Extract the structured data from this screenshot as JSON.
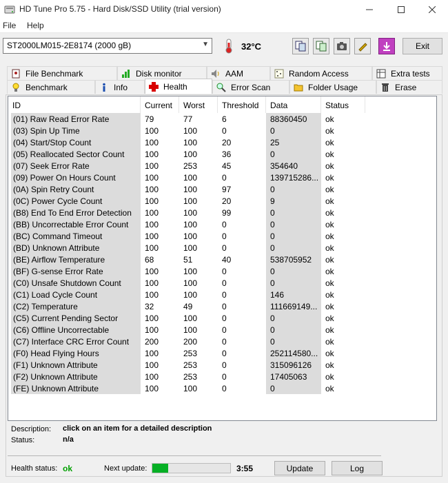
{
  "window": {
    "title": "HD Tune Pro 5.75 - Hard Disk/SSD Utility (trial version)"
  },
  "menu": {
    "file": "File",
    "help": "Help"
  },
  "toolbar": {
    "drive": "ST2000LM015-2E8174 (2000 gB)",
    "temperature": "32°C",
    "exit_label": "Exit"
  },
  "tabs_top": [
    {
      "label": "File Benchmark",
      "icon": "file-benchmark-icon"
    },
    {
      "label": "Disk monitor",
      "icon": "disk-monitor-icon"
    },
    {
      "label": "AAM",
      "icon": "speaker-icon"
    },
    {
      "label": "Random Access",
      "icon": "random-access-icon"
    },
    {
      "label": "Extra tests",
      "icon": "extra-tests-icon"
    }
  ],
  "tabs_bottom": [
    {
      "label": "Benchmark",
      "icon": "benchmark-icon"
    },
    {
      "label": "Info",
      "icon": "info-icon"
    },
    {
      "label": "Health",
      "icon": "health-cross-icon",
      "active": true
    },
    {
      "label": "Error Scan",
      "icon": "magnifier-icon"
    },
    {
      "label": "Folder Usage",
      "icon": "folder-icon"
    },
    {
      "label": "Erase",
      "icon": "trash-icon"
    }
  ],
  "table": {
    "headers": {
      "id": "ID",
      "current": "Current",
      "worst": "Worst",
      "threshold": "Threshold",
      "data": "Data",
      "status": "Status"
    },
    "rows": [
      {
        "id": "(01) Raw Read Error Rate",
        "current": "79",
        "worst": "77",
        "threshold": "6",
        "data": "88360450",
        "status": "ok"
      },
      {
        "id": "(03) Spin Up Time",
        "current": "100",
        "worst": "100",
        "threshold": "0",
        "data": "0",
        "status": "ok"
      },
      {
        "id": "(04) Start/Stop Count",
        "current": "100",
        "worst": "100",
        "threshold": "20",
        "data": "25",
        "status": "ok"
      },
      {
        "id": "(05) Reallocated Sector Count",
        "current": "100",
        "worst": "100",
        "threshold": "36",
        "data": "0",
        "status": "ok"
      },
      {
        "id": "(07) Seek Error Rate",
        "current": "100",
        "worst": "253",
        "threshold": "45",
        "data": "354640",
        "status": "ok"
      },
      {
        "id": "(09) Power On Hours Count",
        "current": "100",
        "worst": "100",
        "threshold": "0",
        "data": "139715286...",
        "status": "ok"
      },
      {
        "id": "(0A) Spin Retry Count",
        "current": "100",
        "worst": "100",
        "threshold": "97",
        "data": "0",
        "status": "ok"
      },
      {
        "id": "(0C) Power Cycle Count",
        "current": "100",
        "worst": "100",
        "threshold": "20",
        "data": "9",
        "status": "ok"
      },
      {
        "id": "(B8) End To End Error Detection",
        "current": "100",
        "worst": "100",
        "threshold": "99",
        "data": "0",
        "status": "ok"
      },
      {
        "id": "(BB) Uncorrectable Error Count",
        "current": "100",
        "worst": "100",
        "threshold": "0",
        "data": "0",
        "status": "ok"
      },
      {
        "id": "(BC) Command Timeout",
        "current": "100",
        "worst": "100",
        "threshold": "0",
        "data": "0",
        "status": "ok"
      },
      {
        "id": "(BD) Unknown Attribute",
        "current": "100",
        "worst": "100",
        "threshold": "0",
        "data": "0",
        "status": "ok"
      },
      {
        "id": "(BE) Airflow Temperature",
        "current": "68",
        "worst": "51",
        "threshold": "40",
        "data": "538705952",
        "status": "ok"
      },
      {
        "id": "(BF) G-sense Error Rate",
        "current": "100",
        "worst": "100",
        "threshold": "0",
        "data": "0",
        "status": "ok"
      },
      {
        "id": "(C0) Unsafe Shutdown Count",
        "current": "100",
        "worst": "100",
        "threshold": "0",
        "data": "0",
        "status": "ok"
      },
      {
        "id": "(C1) Load Cycle Count",
        "current": "100",
        "worst": "100",
        "threshold": "0",
        "data": "146",
        "status": "ok"
      },
      {
        "id": "(C2) Temperature",
        "current": "32",
        "worst": "49",
        "threshold": "0",
        "data": "111669149...",
        "status": "ok"
      },
      {
        "id": "(C5) Current Pending Sector",
        "current": "100",
        "worst": "100",
        "threshold": "0",
        "data": "0",
        "status": "ok"
      },
      {
        "id": "(C6) Offline Uncorrectable",
        "current": "100",
        "worst": "100",
        "threshold": "0",
        "data": "0",
        "status": "ok"
      },
      {
        "id": "(C7) Interface CRC Error Count",
        "current": "200",
        "worst": "200",
        "threshold": "0",
        "data": "0",
        "status": "ok"
      },
      {
        "id": "(F0) Head Flying Hours",
        "current": "100",
        "worst": "253",
        "threshold": "0",
        "data": "252114580...",
        "status": "ok"
      },
      {
        "id": "(F1) Unknown Attribute",
        "current": "100",
        "worst": "253",
        "threshold": "0",
        "data": "315096126",
        "status": "ok"
      },
      {
        "id": "(F2) Unknown Attribute",
        "current": "100",
        "worst": "253",
        "threshold": "0",
        "data": "17405063",
        "status": "ok"
      },
      {
        "id": "(FE) Unknown Attribute",
        "current": "100",
        "worst": "100",
        "threshold": "0",
        "data": "0",
        "status": "ok"
      }
    ]
  },
  "details": {
    "description_label": "Description:",
    "description_value": "click on an item for a detailed description",
    "status_label": "Status:",
    "status_value": "n/a"
  },
  "footer": {
    "health_label": "Health status:",
    "health_value": "ok",
    "next_update_label": "Next update:",
    "progress_fraction": 0.2,
    "countdown": "3:55",
    "update_label": "Update",
    "log_label": "Log",
    "ok_color": "#00a000",
    "progress_color": "#06b025"
  }
}
